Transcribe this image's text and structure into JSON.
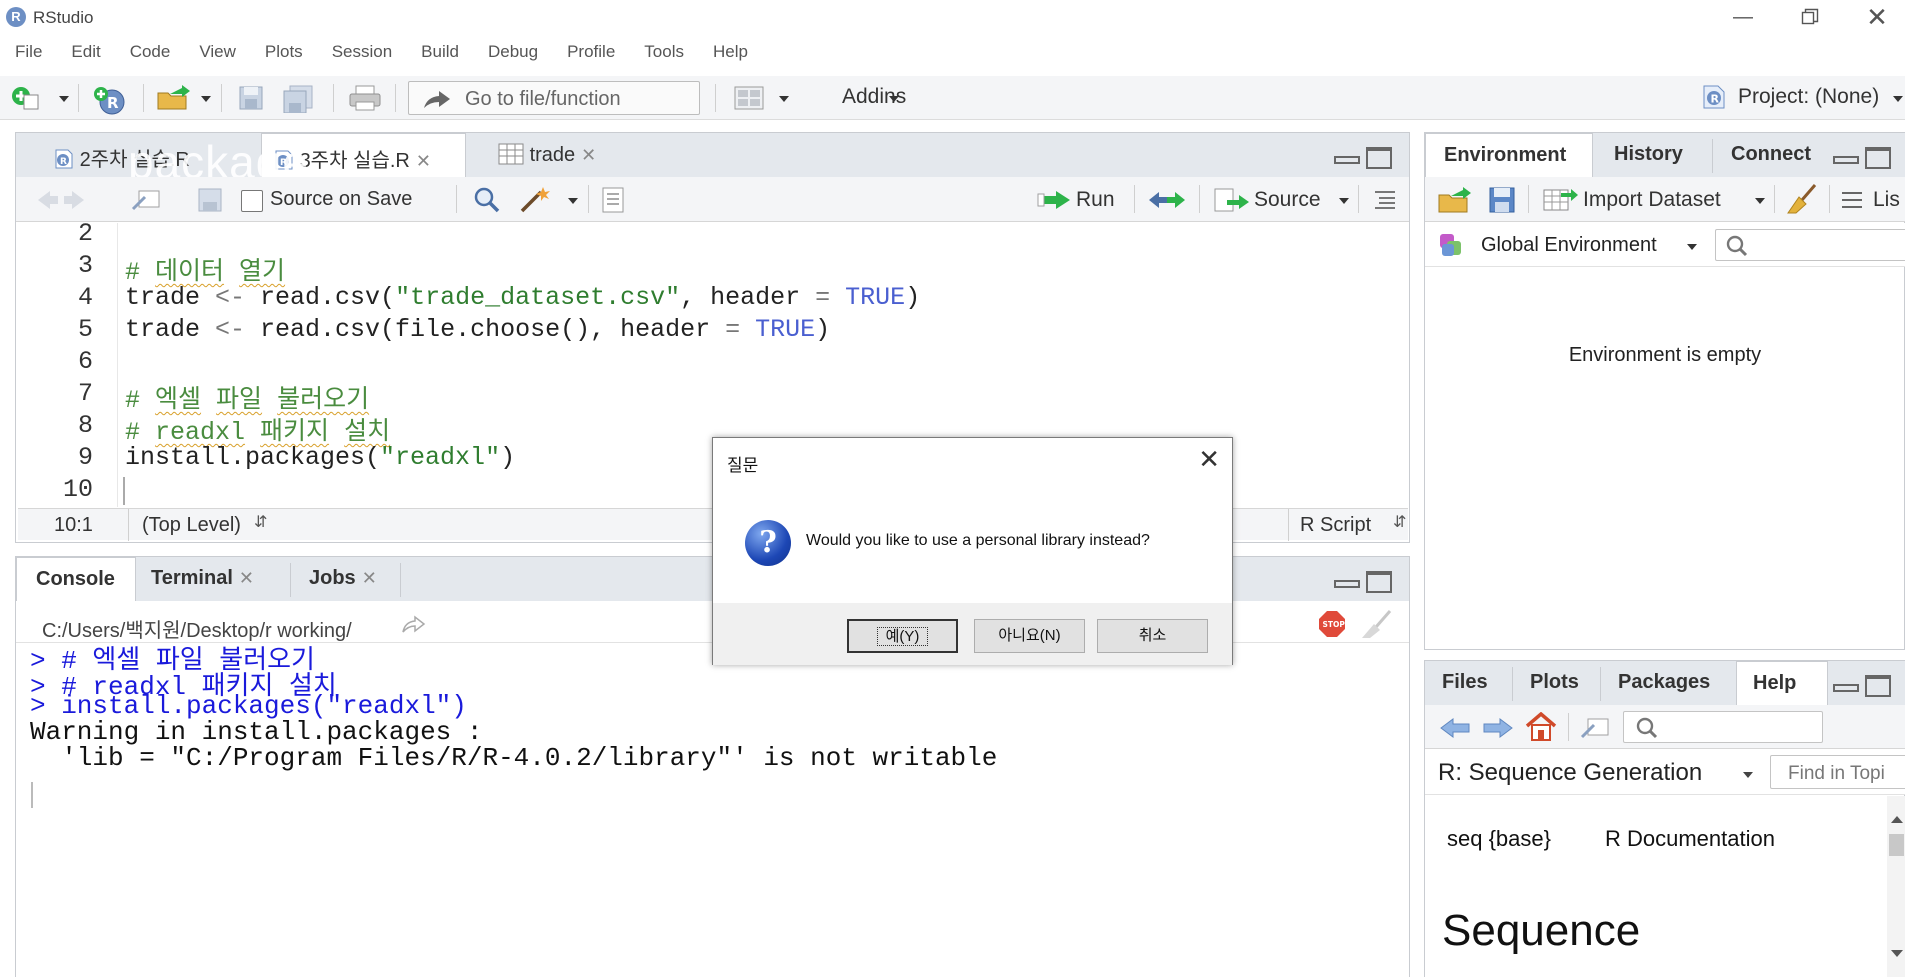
{
  "window": {
    "title": "RStudio",
    "logo_letter": "R"
  },
  "menu": [
    "File",
    "Edit",
    "Code",
    "View",
    "Plots",
    "Session",
    "Build",
    "Debug",
    "Profile",
    "Tools",
    "Help"
  ],
  "toolbar": {
    "goto_placeholder": "Go to file/function",
    "addins_label": "Addins",
    "project_label": "Project: (None)"
  },
  "editor": {
    "tabs": [
      {
        "label": "2주차 실습.R",
        "active": false
      },
      {
        "label": "3주차 실습.R",
        "active": true
      },
      {
        "label": "trade",
        "active": false
      }
    ],
    "ghost_text": "package",
    "source_on_save_label": "Source on Save",
    "run_label": "Run",
    "source_label": "Source",
    "line_numbers": [
      "2",
      "3",
      "4",
      "5",
      "6",
      "7",
      "8",
      "9",
      "10"
    ],
    "cursor_position": "10:1",
    "scope": "(Top Level)",
    "file_type": "R Script"
  },
  "console": {
    "tabs": [
      "Console",
      "Terminal",
      "Jobs"
    ],
    "working_dir": "C:/Users/백지원/Desktop/r working/",
    "lines": [
      {
        "type": "input",
        "text": "> # 엑셀 파일 불러오기"
      },
      {
        "type": "input",
        "text": "> # readxl 패키지 설치"
      },
      {
        "type": "input",
        "text": "> install.packages(\"readxl\")"
      },
      {
        "type": "output",
        "text": "Warning in install.packages :"
      },
      {
        "type": "output",
        "text": "  'lib = \"C:/Program Files/R/R-4.0.2/library\"' is not writable"
      }
    ]
  },
  "environment": {
    "tabs": [
      "Environment",
      "History",
      "Connect"
    ],
    "import_dataset_label": "Import Dataset",
    "list_label": "Lis",
    "scope_label": "Global Environment",
    "empty_message": "Environment is empty"
  },
  "files_pane": {
    "tabs": [
      "Files",
      "Plots",
      "Packages",
      "Help"
    ],
    "help_topic": "R: Sequence Generation",
    "find_placeholder": "Find in Topi",
    "doc_left": "seq {base}",
    "doc_right": "R Documentation",
    "doc_heading": "Sequence"
  },
  "dialog": {
    "title": "질문",
    "message": "Would you like to use a personal library instead?",
    "yes_label": "예(Y)",
    "no_label": "아니요(N)",
    "cancel_label": "취소"
  }
}
